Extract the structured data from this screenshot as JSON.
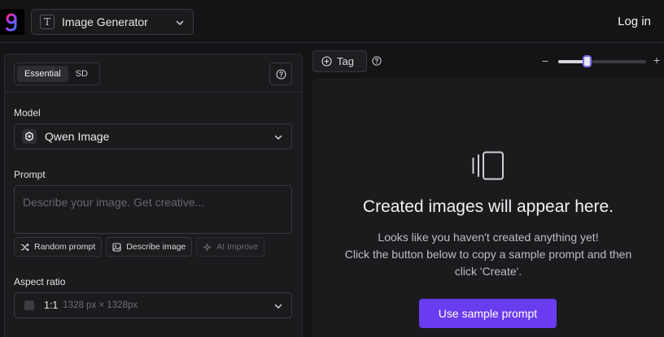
{
  "header": {
    "generator_label": "Image Generator",
    "login_label": "Log in"
  },
  "left_panel": {
    "modes": [
      "Essential",
      "SD"
    ],
    "active_mode": "Essential",
    "model": {
      "label": "Model",
      "value": "Qwen Image"
    },
    "prompt": {
      "label": "Prompt",
      "placeholder": "Describe your image. Get creative...",
      "actions": [
        "Random prompt",
        "Describe image",
        "AI Improve"
      ]
    },
    "aspect": {
      "label": "Aspect ratio",
      "ratio": "1:1",
      "pixels": "1328 px × 1328px"
    }
  },
  "toolbar": {
    "tag_label": "Tag",
    "zoom_level": 0.33
  },
  "empty_state": {
    "title": "Created images will appear here.",
    "line1": "Looks like you haven't created anything yet!",
    "line2": "Click the button below to copy a sample prompt and then",
    "line3": "click 'Create'.",
    "button_label": "Use sample prompt"
  },
  "colors": {
    "accent": "#6a3cf0",
    "background": "#141416",
    "panel": "#1b1b1e"
  }
}
